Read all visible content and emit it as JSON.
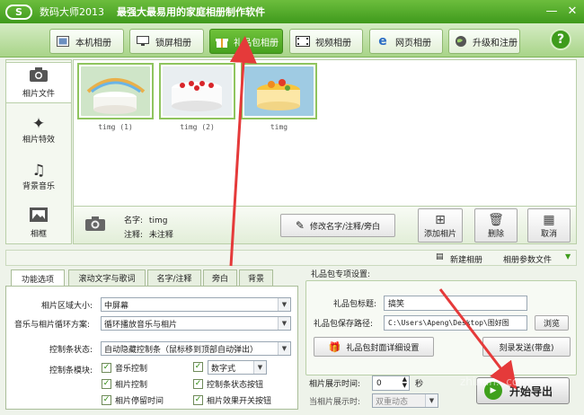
{
  "window": {
    "logo_text": "S",
    "app_name": "数码大师2013",
    "slogan": "最强大最易用的家庭相册制作软件",
    "btn_min": "—",
    "btn_close": "✕"
  },
  "nav": {
    "tabs": [
      {
        "label": "本机相册",
        "icon": "photo-frame-icon"
      },
      {
        "label": "锁屏相册",
        "icon": "monitor-icon"
      },
      {
        "label": "礼品包相册",
        "icon": "gift-icon",
        "active": true
      },
      {
        "label": "视频相册",
        "icon": "film-icon"
      },
      {
        "label": "网页相册",
        "icon": "ie-icon"
      },
      {
        "label": "升级和注册",
        "icon": "globe-icon"
      }
    ],
    "help": "?"
  },
  "sidebar": {
    "items": [
      {
        "label": "相片文件",
        "icon": "camera-icon",
        "active": true
      },
      {
        "label": "相片特效",
        "icon": "effects-icon"
      },
      {
        "label": "背景音乐",
        "icon": "music-note-icon"
      },
      {
        "label": "相框",
        "icon": "frame-icon"
      }
    ]
  },
  "photos": [
    {
      "caption": "timg (1)"
    },
    {
      "caption": "timg (2)"
    },
    {
      "caption": "timg"
    }
  ],
  "info": {
    "name_label": "名字:",
    "name_value": "timg",
    "note_label": "注释:",
    "note_value": "未注释",
    "edit_button": "修改名字/注释/旁白",
    "add_button": "添加相片",
    "delete_button": "删除",
    "cancel_button": "取消"
  },
  "status": {
    "new_album": "新建相册",
    "album_params": "相册参数文件"
  },
  "lower_tabs": [
    "功能选项",
    "滚动文字与歌词",
    "名字/注释",
    "旁白",
    "背景"
  ],
  "options": {
    "area_size_label": "相片区域大小:",
    "area_size_value": "中屏幕",
    "loop_label": "音乐与相片循环方案:",
    "loop_value": "循环播放音乐与相片",
    "ctrl_state_label": "控制条状态:",
    "ctrl_state_value": "自动隐藏控制条（鼠标移到顶部自动弹出）",
    "ctrl_module_label": "控制条模块:",
    "checkboxes": [
      {
        "label": "音乐控制",
        "checked": true
      },
      {
        "label": "相片控制",
        "checked": true
      },
      {
        "label": "相片停留时间",
        "checked": true
      },
      {
        "label": "控制条状态按钮",
        "checked": true
      },
      {
        "label": "相片效果开关按钮",
        "checked": true
      }
    ],
    "digital_check": true,
    "digital_value": "数字式"
  },
  "gift": {
    "group_title": "礼品包专项设置:",
    "title_label": "礼品包标题:",
    "title_value": "搞笑",
    "path_label": "礼品包保存路径:",
    "path_value": "C:\\Users\\Apeng\\Desktop\\图好图",
    "browse_button": "浏览",
    "cover_button": "礼品包封面详细设置",
    "send_button": "刻录发送(带盘)",
    "show_time_label": "相片展示时间:",
    "show_time_value": "0",
    "show_time_unit": "秒",
    "when_label": "当相片展示时:",
    "when_value": "双重动态"
  },
  "start_button": "开始导出",
  "watermark": "zhinan...com",
  "colors": {
    "brand_green": "#46a11e",
    "annotation_red": "#e53a3a"
  }
}
